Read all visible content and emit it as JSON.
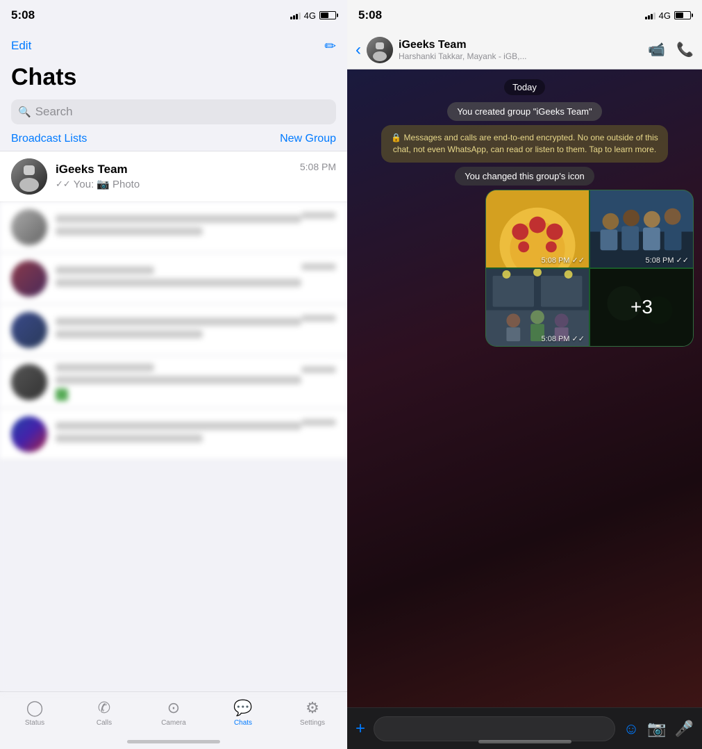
{
  "left": {
    "status_time": "5:08",
    "network": "4G",
    "edit_label": "Edit",
    "title": "Chats",
    "search_placeholder": "Search",
    "broadcast_label": "Broadcast Lists",
    "new_group_label": "New Group",
    "featured_chat": {
      "name": "iGeeks Team",
      "time": "5:08 PM",
      "preview_you": "You:",
      "preview_icon": "📷",
      "preview_text": "Photo"
    },
    "tabs": [
      {
        "id": "status",
        "label": "Status",
        "icon": "○",
        "active": false
      },
      {
        "id": "calls",
        "label": "Calls",
        "icon": "✆",
        "active": false
      },
      {
        "id": "camera",
        "label": "Camera",
        "icon": "⊙",
        "active": false
      },
      {
        "id": "chats",
        "label": "Chats",
        "icon": "💬",
        "active": true
      },
      {
        "id": "settings",
        "label": "Settings",
        "icon": "⚙",
        "active": false
      }
    ]
  },
  "right": {
    "status_time": "5:08",
    "network": "4G",
    "group_name": "iGeeks Team",
    "group_members": "Harshanki Takkar, Mayank - iGB,...",
    "date_badge": "Today",
    "created_msg": "You created group \"iGeeks Team\"",
    "security_msg": "🔒 Messages and calls are end-to-end encrypted. No one outside of this chat, not even WhatsApp, can read or listen to them. Tap to learn more.",
    "icon_change_msg": "You changed this group's icon",
    "photo_timestamps": [
      "5:08 PM ✓✓",
      "5:08 PM ✓✓",
      "5:08 PM ✓✓"
    ],
    "more_label": "+3",
    "input_plus": "+",
    "sticker_icon": "☺",
    "camera_icon": "📷",
    "mic_icon": "🎤"
  }
}
